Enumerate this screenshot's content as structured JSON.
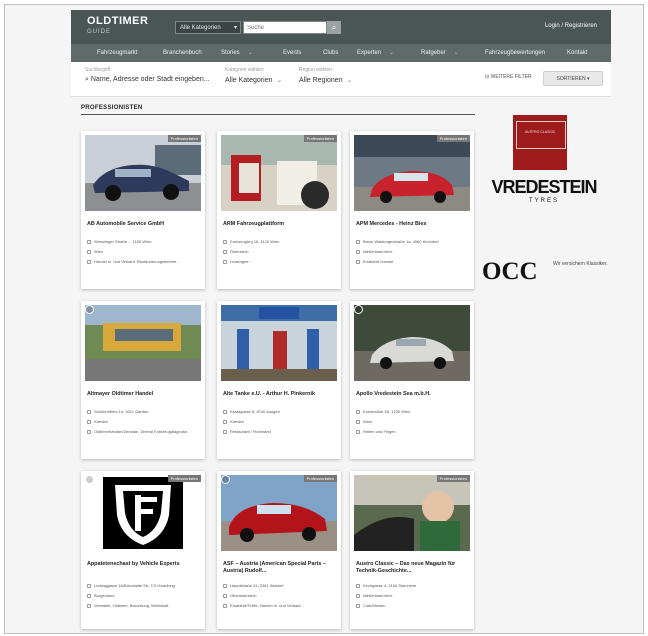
{
  "header": {
    "logo_main": "OLDTIMER",
    "logo_sub": "GUIDE",
    "category_select": "Alle Kategorien",
    "search_placeholder": "Suche",
    "login": "Login / Registrieren"
  },
  "nav": [
    "Fahrzeugmarkt",
    "Branchenbuch",
    "Stories",
    "Events",
    "Clubs",
    "Experten",
    "Ratgeber",
    "Fahrzeugbewertungen",
    "Kontakt"
  ],
  "filters": {
    "search_label": "Suchbegriff",
    "search_value": "Name, Adresse oder Stadt eingeben...",
    "category_label": "Kategorie wählen",
    "category_value": "Alle Kategorien",
    "region_label": "Region wählen",
    "region_value": "Alle Regionen",
    "more_filters": "WEITERE FILTER",
    "sort": "SORTIEREN"
  },
  "section_title": "PROFESSIONISTEN",
  "badge": "Professionisten",
  "cards": [
    {
      "title": "AB Automobile Service GmbH",
      "lines": [
        "Weinzinger Straße ... 1150 Wien",
        "Wien",
        "Handel m. und Verkauf, Restaurierungsbetrieb..."
      ]
    },
    {
      "title": "ARM Fahrzeugplattform",
      "lines": [
        "Fahrzeughrg 16, 1120 Wien",
        "Österreich",
        "Leasinghe..."
      ]
    },
    {
      "title": "APM Mercedes - Heinz Bies",
      "lines": [
        "Bruck Waldungerstraße 1a, 4580 Kirchdorf",
        "Niederösterreich",
        "Ersatzteil Handel"
      ]
    },
    {
      "title": "Altmayer Oldtimer Handel",
      "lines": [
        "Schönrüttlers 14, 9011 Garden",
        "Kärnten",
        "Oldtimerhändler/Zentrale, Zentral Fahrzeugdiagnose..."
      ]
    },
    {
      "title": "Alte Tanke e.U. - Arthur H. Pinkernik",
      "lines": [
        "Kastagasse 8, 8740 Ausgen",
        "Kärnten",
        "Restaurant / Flohmarkt"
      ]
    },
    {
      "title": "Apollo Vredestein Sea m.b.H.",
      "lines": [
        "Kolomaßstr 56, 1230 Wien",
        "Wien",
        "Reifen und Felgen"
      ]
    },
    {
      "title": "Appatetenschast by Vehicle Experts",
      "lines": [
        "Ludwiggasse 16/Bürostalte Str. 7/3 Vorarlberg",
        "Burgenland",
        "Verwaltet, Oldtimer, Bewertung, Werkstatt..."
      ]
    },
    {
      "title": "ASF – Austria (American Special Parts – Austria) Rudolf...",
      "lines": [
        "Hauptstraße 24, 2381 Waldorf",
        "Oberösterreich",
        "Ersatzteil/Teilfix, Handel m. und Verkauf..."
      ]
    },
    {
      "title": "Austro Classic – Das neue Magazin für Technik-Geschichte...",
      "lines": [
        "Kirchgasse 4, 3100 Steinheim",
        "Niederösterreich",
        "Club/Medien"
      ]
    }
  ],
  "sidebar": {
    "ad_box_text": "AUSTRO CLASSIC",
    "vredestein": "VREDESTEIN",
    "tyres": "TYRES",
    "occ": "OCC",
    "occ_tagline": "Wir versichern Klassiker."
  },
  "colors": {
    "topbar": "#4a5654",
    "navbar": "#5f6b69",
    "ad_red": "#9e1b1b"
  },
  "icons": [
    "search-icon",
    "chevron-down-icon",
    "favorite-icon"
  ]
}
